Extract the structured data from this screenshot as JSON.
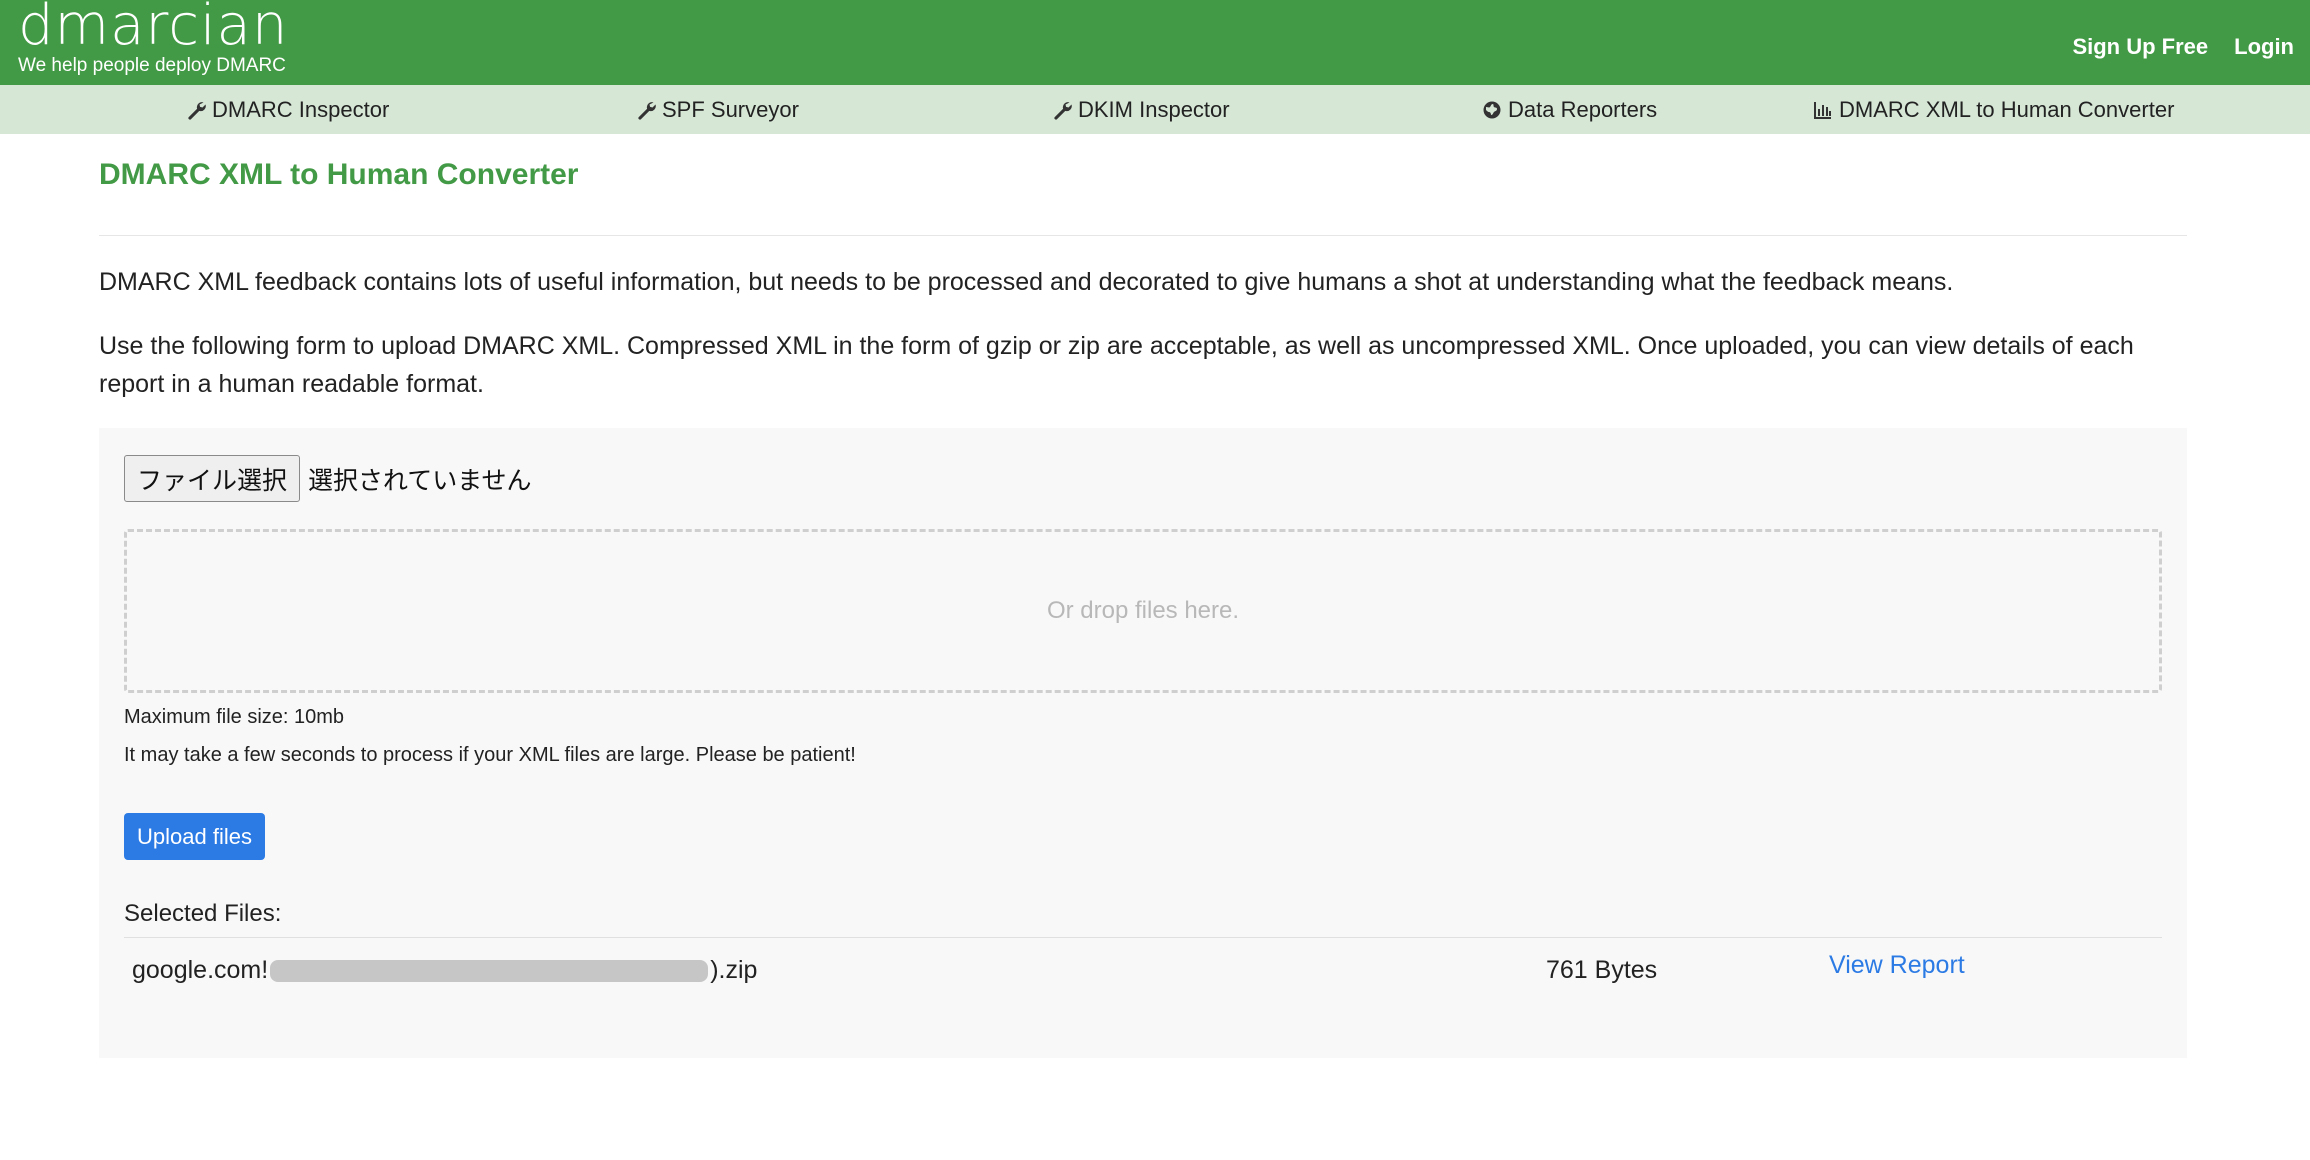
{
  "header": {
    "logo_text": "dmarcian",
    "tagline": "We help people deploy DMARC",
    "links": {
      "signup": "Sign Up Free",
      "login": "Login"
    },
    "colors": {
      "header_bg": "#439a46",
      "nav_bg": "#d6e7d6"
    }
  },
  "nav": {
    "items": [
      {
        "label": "DMARC Inspector",
        "icon": "wrench-icon"
      },
      {
        "label": "SPF Surveyor",
        "icon": "wrench-icon"
      },
      {
        "label": "DKIM Inspector",
        "icon": "wrench-icon"
      },
      {
        "label": "Data Reporters",
        "icon": "globe-icon"
      },
      {
        "label": "DMARC XML to Human Converter",
        "icon": "bar-chart-icon"
      }
    ]
  },
  "main": {
    "title": "DMARC XML to Human Converter",
    "paragraph1": "DMARC XML feedback contains lots of useful information, but needs to be processed and decorated to give humans a shot at understanding what the feedback means.",
    "paragraph2": "Use the following form to upload DMARC XML. Compressed XML in the form of gzip or zip are acceptable, as well as uncompressed XML. Once uploaded, you can view details of each report in a human readable format."
  },
  "upload": {
    "file_button_label": "ファイル選択",
    "file_status": "選択されていません",
    "dropzone_text": "Or drop files here.",
    "max_size_note": "Maximum file size: 10mb",
    "patience_note": "It may take a few seconds to process if your XML files are large. Please be patient!",
    "upload_button_label": "Upload files",
    "accent_color": "#2c7be5"
  },
  "selected_files": {
    "label": "Selected Files:",
    "files": [
      {
        "name_prefix": "google.com!",
        "name_suffix": ").zip",
        "size": "761 Bytes",
        "action_label": "View Report"
      }
    ]
  }
}
